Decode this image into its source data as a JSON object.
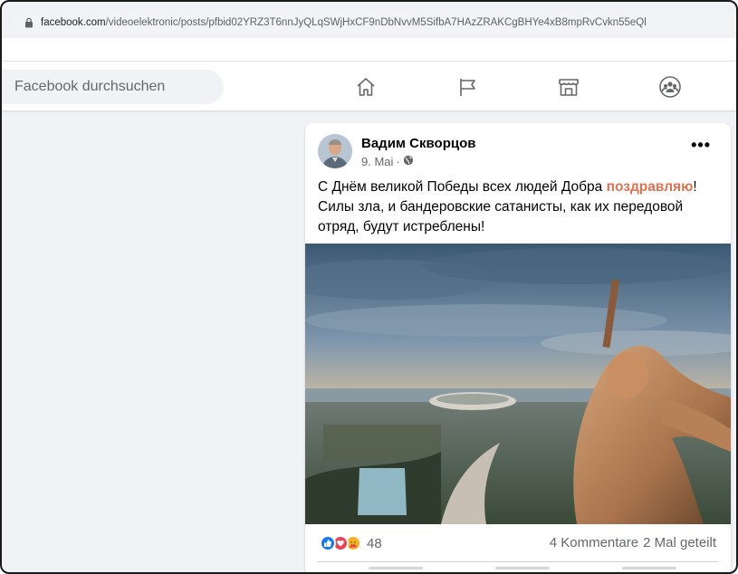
{
  "browser": {
    "url_host": "facebook.com",
    "url_path": "/videoelektronic/posts/pfbid02YRZ3T6nnJyQLqSWjHxCF9nDbNvvM5SifbA7HAzZRAKCgBHYe4xB8mpRvCvkn55eQl",
    "lock_icon": "lock-icon"
  },
  "nav": {
    "search_placeholder": "Facebook durchsuchen",
    "icons": [
      "home-icon",
      "pages-flag-icon",
      "marketplace-icon",
      "groups-icon"
    ]
  },
  "post": {
    "author": "Вадим Скворцов",
    "date": "9. Mai",
    "date_separator": "·",
    "audience_icon": "globe-icon",
    "more_label": "•••",
    "text_before": "С Днём великой Победы всех людей Добра ",
    "text_highlight": "поздравляю",
    "text_after": "! Силы зла, и бандеровские сатанисты, как их передовой отряд, будут истреблены!",
    "highlight_color": "#e2724f",
    "image_description_icon": "photo-image",
    "reactions": {
      "icons": [
        "like-icon",
        "love-icon",
        "care-icon"
      ],
      "count": "48"
    },
    "comments": "4 Kommentare",
    "shares": "2 Mal geteilt"
  },
  "colors": {
    "background": "#f0f2f5",
    "like_blue": "#1877f2",
    "love_red": "#f33e58",
    "care_yellow": "#f7b125"
  }
}
